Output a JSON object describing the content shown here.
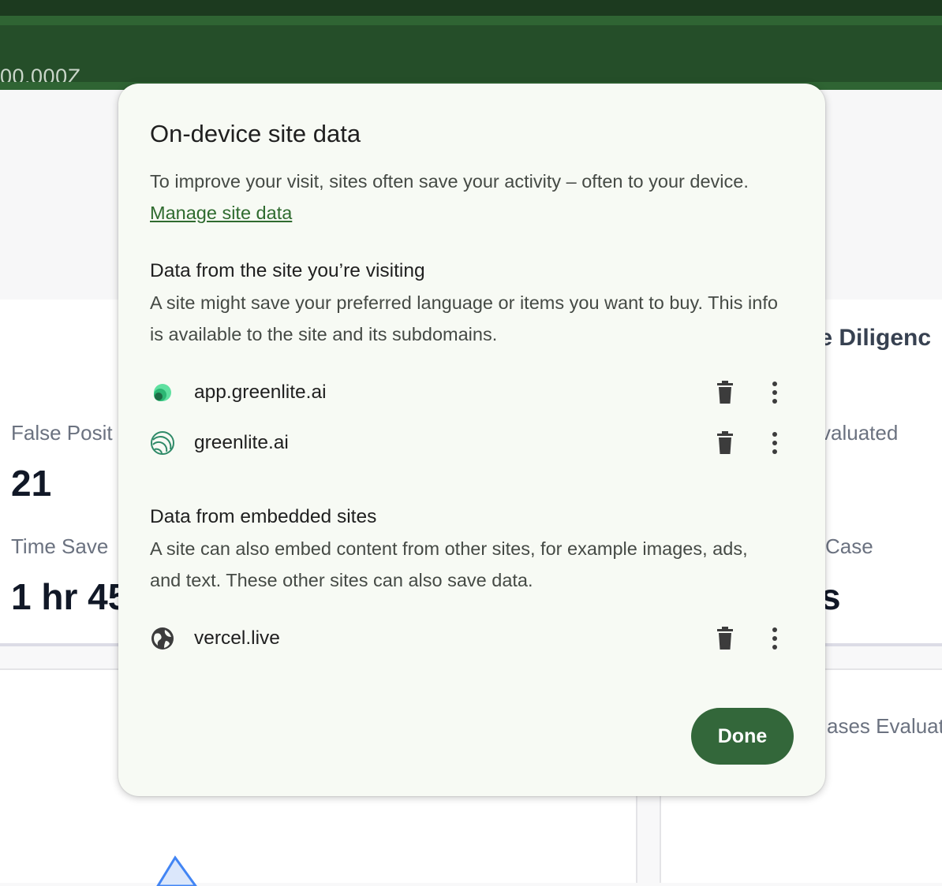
{
  "browser": {
    "url_fragment": "00.000Z"
  },
  "background": {
    "stats_left": [
      {
        "label": "False Posit",
        "value": "21"
      },
      {
        "label": "Time Save",
        "value": "1 hr 45"
      }
    ],
    "heading_right": "ue Diligenc",
    "stats_right": [
      {
        "label": "valuated"
      },
      {
        "label": "Case",
        "value": "s"
      }
    ],
    "bottom_right_label": "ases Evaluat",
    "accent_color": "#4285f4"
  },
  "dialog": {
    "title": "On-device site data",
    "intro": "To improve your visit, sites often save your activity – often to your device.",
    "manage_link": "Manage site data",
    "section_visiting": {
      "heading": "Data from the site you’re visiting",
      "description": "A site might save your preferred language or items you want to buy. This info is available to the site and its subdomains.",
      "sites": [
        {
          "name": "app.greenlite.ai",
          "icon": "greenlite-app-icon"
        },
        {
          "name": "greenlite.ai",
          "icon": "greenlite-icon"
        }
      ]
    },
    "section_embedded": {
      "heading": "Data from embedded sites",
      "description": "A site can also embed content from other sites, for example images, ads, and text. These other sites can also save data.",
      "sites": [
        {
          "name": "vercel.live",
          "icon": "globe-icon"
        }
      ]
    },
    "done_label": "Done",
    "colors": {
      "dialog_bg": "#f7faf4",
      "button_bg": "#33673a",
      "link": "#2f6b2f",
      "toolbar": "#254e29"
    }
  }
}
